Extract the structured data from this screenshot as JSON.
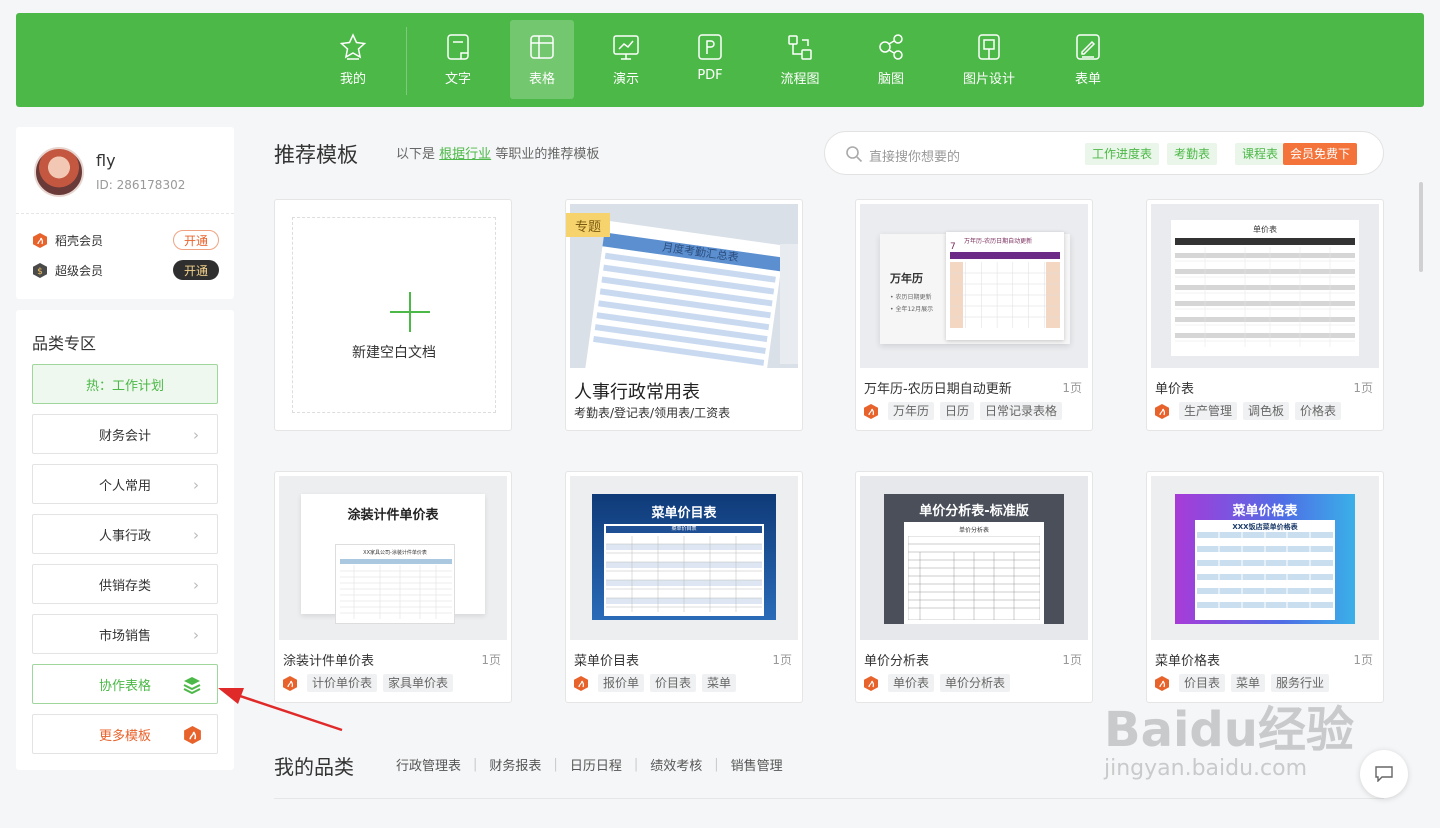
{
  "topnav": {
    "items": [
      {
        "label": "我的",
        "icon": "star-icon"
      },
      {
        "label": "文字",
        "icon": "document-icon"
      },
      {
        "label": "表格",
        "icon": "spreadsheet-icon",
        "active": true
      },
      {
        "label": "演示",
        "icon": "presentation-icon"
      },
      {
        "label": "PDF",
        "icon": "pdf-icon"
      },
      {
        "label": "流程图",
        "icon": "flowchart-icon"
      },
      {
        "label": "脑图",
        "icon": "mindmap-icon"
      },
      {
        "label": "图片设计",
        "icon": "image-design-icon"
      },
      {
        "label": "表单",
        "icon": "form-icon"
      }
    ],
    "color": "#4cb847"
  },
  "user": {
    "name": "fly",
    "id": "ID: 286178302",
    "memberships": [
      {
        "label": "稻壳会员",
        "button": "开通"
      },
      {
        "label": "超级会员",
        "button": "开通"
      }
    ]
  },
  "categories": {
    "title": "品类专区",
    "hot": "热：工作计划",
    "items": [
      "财务会计",
      "个人常用",
      "人事行政",
      "供销存类",
      "市场销售"
    ],
    "collab": "协作表格",
    "more": "更多模板"
  },
  "main": {
    "title": "推荐模板",
    "subtitle_prefix": "以下是",
    "subtitle_link": "根据行业",
    "subtitle_suffix": "等职业的推荐模板"
  },
  "search": {
    "placeholder": "直接搜你想要的",
    "tags": [
      "工作进度表",
      "考勤表",
      "课程表"
    ],
    "promo": "会员免费下"
  },
  "cards": {
    "new_doc": "新建空白文档",
    "featured": {
      "badge": "专题",
      "title": "人事行政常用表",
      "sub": "考勤表/登记表/领用表/工资表",
      "thumb_title": "月度考勤汇总表"
    },
    "items": [
      {
        "title": "万年历-农历日期自动更新",
        "pages": "1页",
        "tags": [
          "万年历",
          "日历",
          "日常记录表格"
        ],
        "thumb_title": "万年历-农历日期自动更新",
        "thumb_side": "万年历",
        "thumb_bullets": [
          "农历日期更新",
          "全年12月展示"
        ],
        "cal_month": "7"
      },
      {
        "title": "单价表",
        "pages": "1页",
        "tags": [
          "生产管理",
          "调色板",
          "价格表"
        ],
        "thumb_title": "单价表"
      },
      {
        "title": "涂装计件单价表",
        "pages": "1页",
        "tags": [
          "计价单价表",
          "家具单价表"
        ],
        "thumb_title": "涂装计件单价表",
        "thumb_sub": "XX家具公司-涂装计件单价表"
      },
      {
        "title": "菜单价目表",
        "pages": "1页",
        "tags": [
          "报价单",
          "价目表",
          "菜单"
        ],
        "thumb_title": "菜单价目表",
        "thumb_sub": "菜单价目表"
      },
      {
        "title": "单价分析表",
        "pages": "1页",
        "tags": [
          "单价表",
          "单价分析表"
        ],
        "thumb_title": "单价分析表-标准版",
        "thumb_sub": "单价分析表"
      },
      {
        "title": "菜单价格表",
        "pages": "1页",
        "tags": [
          "价目表",
          "菜单",
          "服务行业"
        ],
        "thumb_title": "菜单价格表",
        "thumb_sub": "XXX饭店菜单价格表"
      }
    ]
  },
  "mycat": {
    "title": "我的品类",
    "links": [
      "行政管理表",
      "财务报表",
      "日历日程",
      "绩效考核",
      "销售管理"
    ]
  },
  "watermark": {
    "brand": "Baidu经验",
    "url": "jingyan.baidu.com"
  }
}
